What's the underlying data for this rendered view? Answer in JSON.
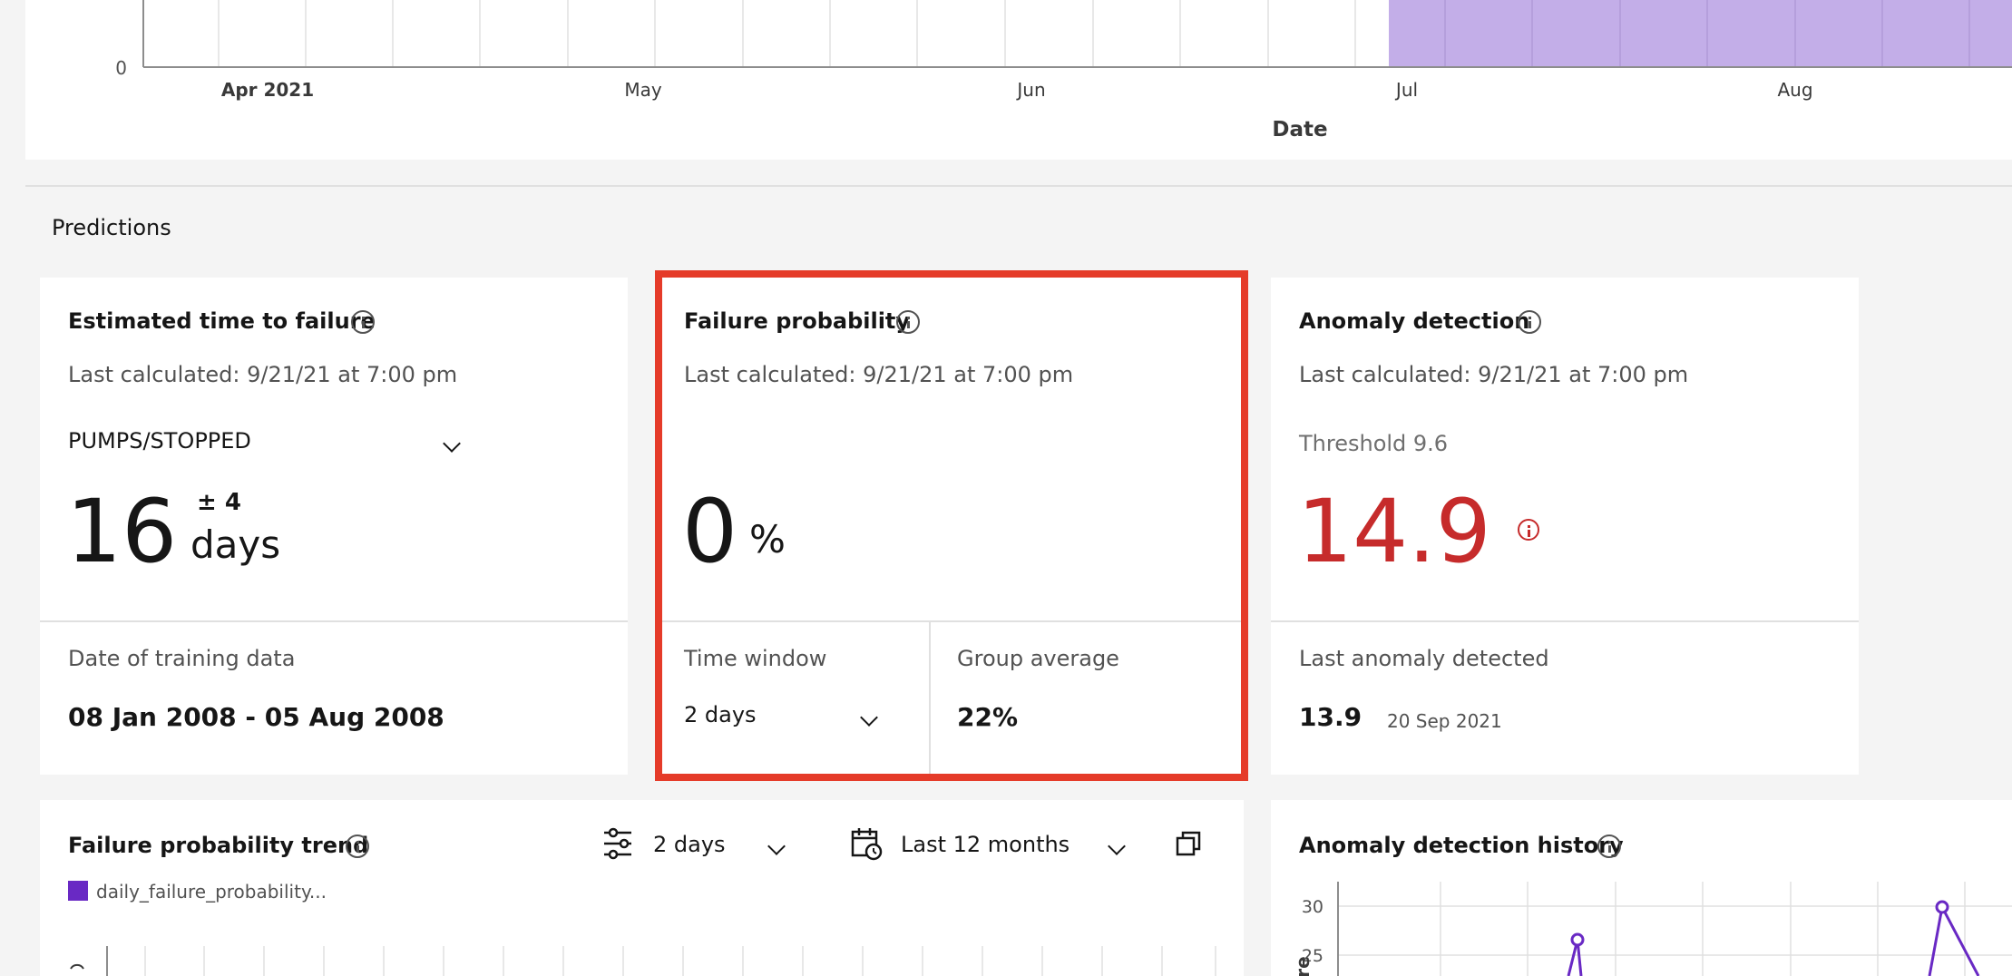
{
  "top_chart": {
    "y_tick": "0",
    "x_ticks": [
      "Apr 2021",
      "May",
      "Jun",
      "Jul",
      "Aug"
    ],
    "x_label": "Date",
    "colors": {
      "band": "#c3aee8",
      "axis": "#8d8d8d",
      "grid": "#e0e0e0"
    }
  },
  "predictions": {
    "section_title": "Predictions",
    "time_to_failure": {
      "title": "Estimated time to failure",
      "last_calculated": "Last calculated: 9/21/21 at 7:00 pm",
      "dropdown_value": "PUMPS/STOPPED",
      "value": "16",
      "tolerance": "± 4",
      "unit": "days",
      "training_label": "Date of training data",
      "training_range": "08 Jan 2008 - 05 Aug 2008"
    },
    "failure_probability": {
      "title": "Failure probability",
      "last_calculated": "Last calculated: 9/21/21 at 7:00 pm",
      "value": "0",
      "unit": "%",
      "time_window_label": "Time window",
      "time_window_value": "2 days",
      "group_average_label": "Group average",
      "group_average_value": "22%",
      "highlight_color": "#e53b29"
    },
    "anomaly_detection": {
      "title": "Anomaly detection",
      "last_calculated": "Last calculated: 9/21/21 at 7:00 pm",
      "threshold": "Threshold 9.6",
      "value": "14.9",
      "value_color": "#c62b2b",
      "last_detected_label": "Last anomaly detected",
      "last_detected_value": "13.9",
      "last_detected_date": "20 Sep 2021"
    }
  },
  "trend": {
    "title": "Failure probability trend",
    "window_value": "2 days",
    "range_value": "Last 12 months",
    "legend_label": "daily_failure_probability...",
    "legend_color": "#6929c4"
  },
  "anomaly_history": {
    "title": "Anomaly detection history",
    "y_ticks": [
      "30",
      "25"
    ],
    "y_label_partial": "re",
    "line_color": "#6929c4"
  }
}
